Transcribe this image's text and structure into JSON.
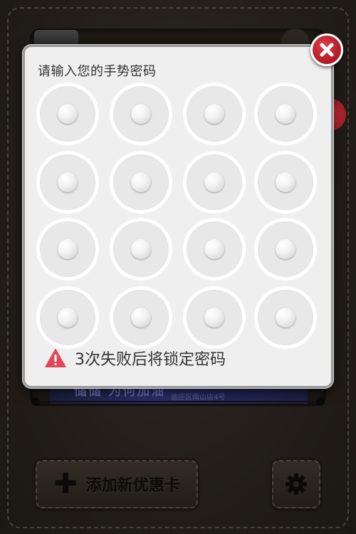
{
  "dialog": {
    "title": "请输入您的手势密码",
    "warning_text": "3次失败后将锁定密码",
    "close_icon": "close-icon",
    "warning_icon": "warning-icon",
    "grid": {
      "rows": 4,
      "cols": 4
    }
  },
  "background_card": {
    "partial_text": "储储   为何加油",
    "partial_subtext": "途庄区南山店4号"
  },
  "toolbar": {
    "add_card_label": "添加新优惠卡",
    "add_icon": "plus-icon",
    "settings_icon": "gear-icon"
  },
  "colors": {
    "close_button": "#c8232e",
    "warning_icon": "#e0485a",
    "dialog_bg": "#efefef",
    "background": "#241f1b"
  }
}
